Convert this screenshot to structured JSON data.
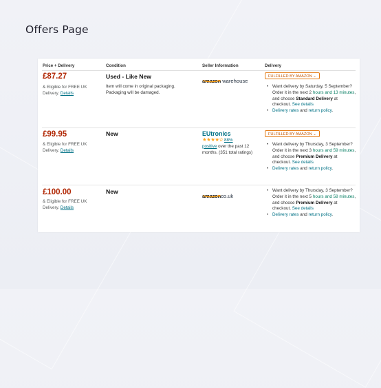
{
  "page_title": "Offers Page",
  "colors": {
    "price": "#b12704",
    "link": "#007185",
    "green": "#067d62",
    "fulfil": "#e47911",
    "star": "#ffa41c"
  },
  "table": {
    "headers": [
      "Price + Delivery",
      "Condition",
      "Seller Information",
      "Delivery"
    ],
    "offers": [
      {
        "price": "£87.27",
        "free_text": "& Eligible for FREE UK Delivery.",
        "details_link": "Details",
        "condition": "Used - Like New",
        "condition_note": "Item will come in original packaging. Packaging will be damaged.",
        "seller_logo": {
          "part1": "amazon",
          "part2": " warehouse",
          "icon": "amazon-smile-logo"
        },
        "fulfilled_badge": "FULFILLED BY AMAZON",
        "delivery": {
          "a": "Want delivery by Saturday, 5 September? Order it in the next 2 ",
          "b": "hours and 13 minutes",
          "c": ", and choose ",
          "d": "Standard Delivery",
          "e": " at checkout. ",
          "f": "See details"
        },
        "rates_link": "Delivery rates",
        "and_text": " and ",
        "return_link": "return policy",
        "end_dot": "."
      },
      {
        "price": "£99.95",
        "free_text": "& Eligible for FREE UK Delivery.",
        "details_link": "Details",
        "condition": "New",
        "seller_name": "EUtronics",
        "stars": "★★★★✫",
        "rating_pct": "88%",
        "rating_positive": "positive",
        "rating_rest": " over the past 12 months. (351 total ratings)",
        "fulfilled_badge": "FULFILLED BY AMAZON",
        "delivery": {
          "a": "Want delivery by Thursday, 3 September? Order it in the next 3 ",
          "b": "hours and 59 minutes",
          "c": ", and choose ",
          "d": "Premium Delivery",
          "e": " at checkout. ",
          "f": "See details"
        },
        "rates_link": "Delivery rates",
        "and_text": " and ",
        "return_link": "return policy",
        "end_dot": "."
      },
      {
        "price": "£100.00",
        "free_text": "& Eligible for FREE UK Delivery.",
        "details_link": "Details",
        "condition": "New",
        "seller_logo": {
          "part1": "amazon",
          "part2": "co.uk",
          "icon": "amazon-smile-logo"
        },
        "delivery": {
          "a": "Want delivery by Thursday, 3 September? Order it in the next 5 ",
          "b": "hours and 58 minutes",
          "c": ", and choose ",
          "d": "Premium Delivery",
          "e": " at checkout. ",
          "f": "See details"
        },
        "rates_link": "Delivery rates",
        "and_text": " and ",
        "return_link": "return policy",
        "end_dot": "."
      }
    ]
  }
}
